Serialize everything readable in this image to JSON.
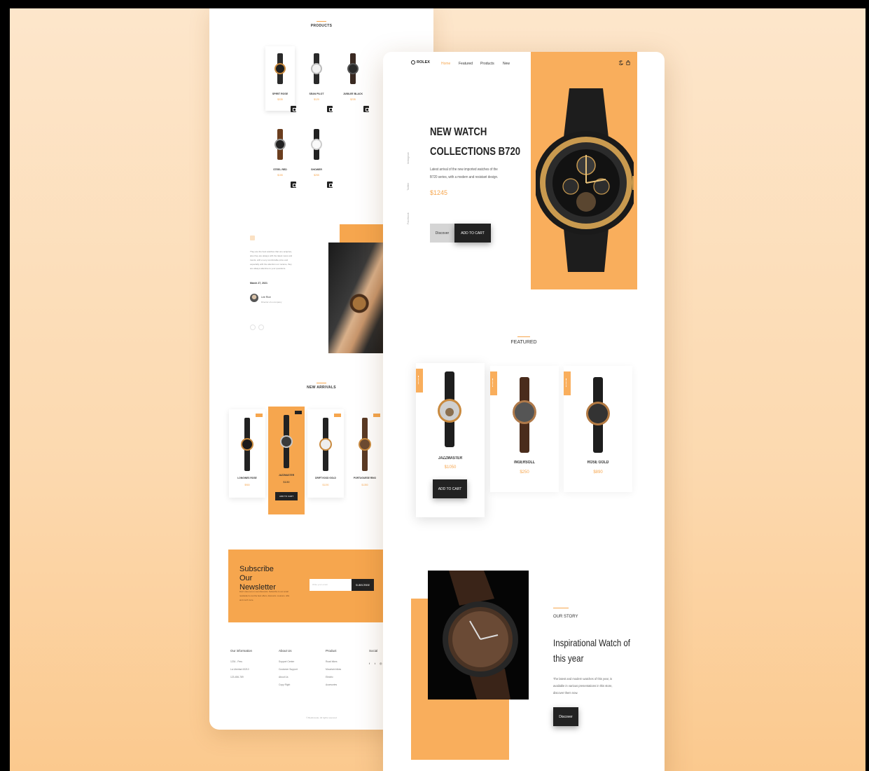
{
  "back_page": {
    "products_heading": "PRODUCTS",
    "products": [
      {
        "name": "SPIRIT ROSE",
        "price": "$335"
      },
      {
        "name": "SEAN PILOT",
        "price": "$120"
      },
      {
        "name": "JUBILEE BLACK",
        "price": "$235"
      },
      {
        "name": "STEEL RED",
        "price": "$155"
      },
      {
        "name": "SHOWER",
        "price": "$255"
      }
    ],
    "testimonial": {
      "quote_mark": "“",
      "text_lines": [
        "They are the best watches that one acquires,",
        "also they are always with the latest news and",
        "trends, with a very comfortable price and",
        "especially with the attention our receive, they",
        "are always attentive to your questions."
      ],
      "date": "March 27, 2021",
      "author_name": "Lee Rice",
      "author_role": "Director of a company"
    },
    "new_arrivals_heading": "NEW ARRIVALS",
    "new_arrivals": [
      {
        "tag": "NEW",
        "name": "LONGINES ROSE",
        "price": "$980"
      },
      {
        "tag": "NEW",
        "name": "JAZZMASTER",
        "price": "$1150",
        "button": "ADD TO CART"
      },
      {
        "tag": "NEW",
        "name": "DRIFTVOOD GOLD",
        "price": "$1190"
      },
      {
        "tag": "NEW",
        "name": "PORTUGUESE RINO",
        "price": "$1350"
      }
    ],
    "newsletter": {
      "title": "Subscribe Our Newsletter",
      "text_lines": [
        "Don't miss out on your discounts. Subscribe to our email",
        "newsletter to get the best offers, discounts, coupons, gifts",
        "and much more."
      ],
      "input_placeholder": "Write your email",
      "button": "SUBSCRIBE"
    },
    "footer": {
      "columns": [
        {
          "title": "Our information",
          "items": [
            "1234 - Peru",
            "La Libertad 43210",
            "123-456-789"
          ]
        },
        {
          "title": "About Us",
          "items": [
            "Support Center",
            "Customer Support",
            "About Us",
            "Copy Right"
          ]
        },
        {
          "title": "Product",
          "items": [
            "Road bikes",
            "Mountain bikes",
            "Electric",
            "Accesories"
          ]
        },
        {
          "title": "Social",
          "items": [
            "f",
            "t",
            "◎"
          ]
        }
      ],
      "copyright": "© Bedimcode. All rigths reserved"
    }
  },
  "front_page": {
    "brand": "ROLEX",
    "nav": [
      "Home",
      "Featured",
      "Products",
      "New"
    ],
    "side_links": [
      "Instagram",
      "Twitter",
      "Facebook"
    ],
    "hero": {
      "title_lines": [
        "NEW WATCH",
        "COLLECTIONS B720"
      ],
      "description_lines": [
        "Latest arrival of the new imported watches of the",
        "B720 series, with a modern and resistant design."
      ],
      "price": "$1245",
      "discover_button": "Discover",
      "cart_button": "ADD TO CART"
    },
    "featured_heading": "FEATURED",
    "featured": [
      {
        "tag": "SALE",
        "name": "JAZZMASTER",
        "price": "$1050",
        "button": "ADD TO CART"
      },
      {
        "tag": "SALE",
        "name": "INGERSOLL",
        "price": "$250"
      },
      {
        "tag": "SALE",
        "name": "ROSE GOLD",
        "price": "$890"
      }
    ],
    "story": {
      "label": "OUR STORY",
      "title_lines": [
        "Inspirational Watch of",
        "this year"
      ],
      "description_lines": [
        "The latest and modern watches of this year, is",
        "available in various presentations in this store,",
        "discover them now."
      ],
      "button": "Discover"
    }
  },
  "colors": {
    "accent": "#f9ae5c",
    "dark": "#222222",
    "background": "#fcd9af"
  }
}
